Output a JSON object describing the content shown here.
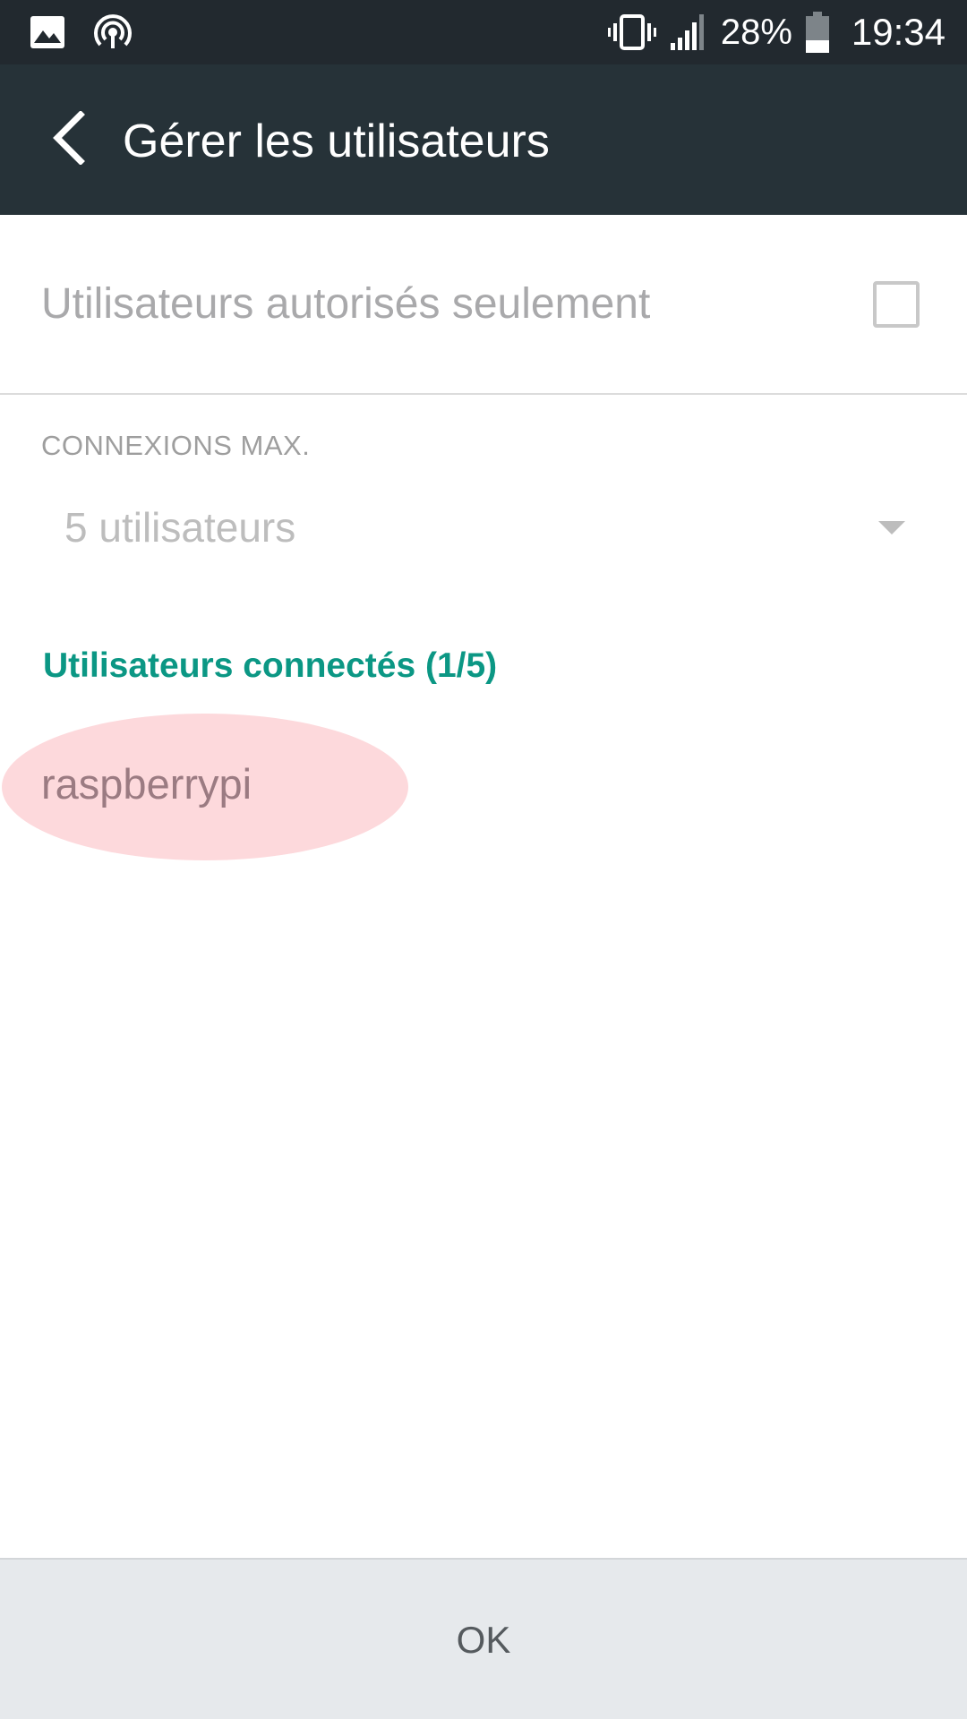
{
  "status_bar": {
    "battery_percent": "28%",
    "time": "19:34",
    "icons": [
      "image-icon",
      "hotspot-icon",
      "vibrate-icon",
      "signal-icon",
      "battery-icon"
    ]
  },
  "app_bar": {
    "title": "Gérer les utilisateurs",
    "back_icon": "chevron-left-icon",
    "background": "#263238"
  },
  "settings": {
    "authorized_only_label": "Utilisateurs autorisés seulement",
    "authorized_only_checked": false,
    "max_connections_label": "CONNEXIONS MAX.",
    "max_connections_value": "5 utilisateurs"
  },
  "connected": {
    "title": "Utilisateurs connectés (1/5)",
    "accent_color": "#0b9784",
    "users": [
      "raspberrypi"
    ]
  },
  "footer": {
    "ok_label": "OK"
  }
}
